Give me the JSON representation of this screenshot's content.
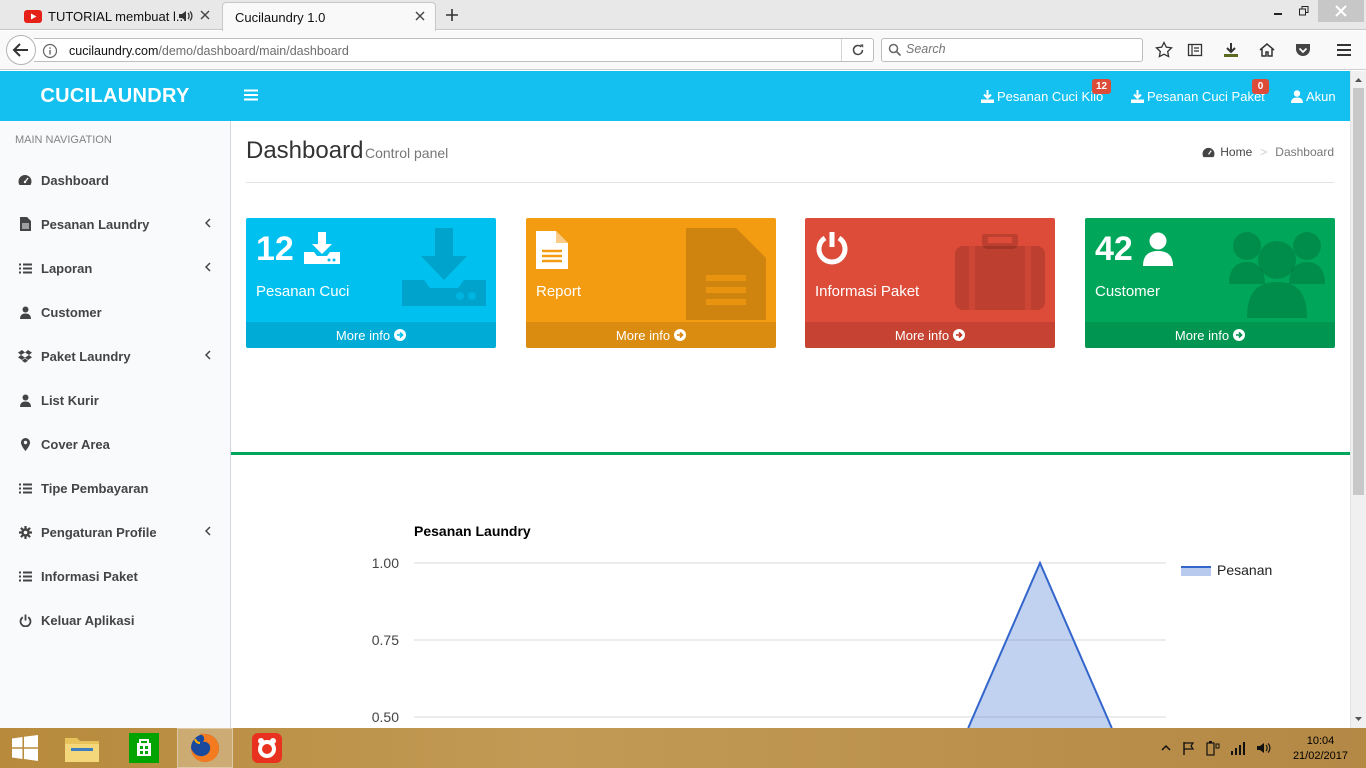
{
  "browser": {
    "tabs": [
      {
        "title": "TUTORIAL membuat l...",
        "favicon": "youtube-icon",
        "audio": true
      },
      {
        "title": "Cucilaundry 1.0",
        "active": true
      }
    ],
    "url_host": "cucilaundry.com",
    "url_path": "/demo/dashboard/main/dashboard",
    "search_placeholder": "Search"
  },
  "app": {
    "brand": "CUCILAUNDRY",
    "header_color": "#13c0ef",
    "nav": {
      "kilo_label": "Pesanan Cuci Kilo",
      "kilo_badge": "12",
      "paket_label": "Pesanan Cuci Paket",
      "paket_badge": "0",
      "akun_label": "Akun"
    }
  },
  "sidebar": {
    "header": "MAIN NAVIGATION",
    "items": [
      {
        "label": "Dashboard",
        "icon": "dashboard-icon"
      },
      {
        "label": "Pesanan Laundry",
        "icon": "file-icon",
        "submenu": true
      },
      {
        "label": "Laporan",
        "icon": "list-icon",
        "submenu": true
      },
      {
        "label": "Customer",
        "icon": "user-icon"
      },
      {
        "label": "Paket Laundry",
        "icon": "dropbox-icon",
        "submenu": true
      },
      {
        "label": "List Kurir",
        "icon": "user-icon"
      },
      {
        "label": "Cover Area",
        "icon": "map-marker-icon"
      },
      {
        "label": "Tipe Pembayaran",
        "icon": "list-icon"
      },
      {
        "label": "Pengaturan Profile",
        "icon": "gear-icon",
        "submenu": true
      },
      {
        "label": "Informasi Paket",
        "icon": "list-icon"
      },
      {
        "label": "Keluar Aplikasi",
        "icon": "power-icon"
      }
    ]
  },
  "page": {
    "title": "Dashboard",
    "subtitle": "Control panel",
    "breadcrumb": {
      "home": "Home",
      "current": "Dashboard"
    }
  },
  "boxes": [
    {
      "number": "12",
      "label": "Pesanan Cuci",
      "footer": "More info",
      "color": "#00c0ef"
    },
    {
      "number": "",
      "label": "Report",
      "footer": "More info",
      "color": "#f39c12"
    },
    {
      "number": "",
      "label": "Informasi Paket",
      "footer": "More info",
      "color": "#dd4b39"
    },
    {
      "number": "42",
      "label": "Customer",
      "footer": "More info",
      "color": "#00a65a"
    }
  ],
  "chart_data": {
    "type": "area",
    "title": "Pesanan Laundry",
    "series": [
      {
        "name": "Pesanan",
        "color": "#3366cc"
      }
    ],
    "y_ticks": [
      "1.00",
      "0.75",
      "0.50"
    ],
    "visible_points": [
      {
        "y": 0.5
      },
      {
        "y": 1.0
      },
      {
        "y": 0.5
      }
    ],
    "ylim_visible": [
      0.5,
      1.0
    ],
    "legend_position": "right"
  },
  "taskbar": {
    "time": "10:04",
    "date": "21/02/2017"
  }
}
